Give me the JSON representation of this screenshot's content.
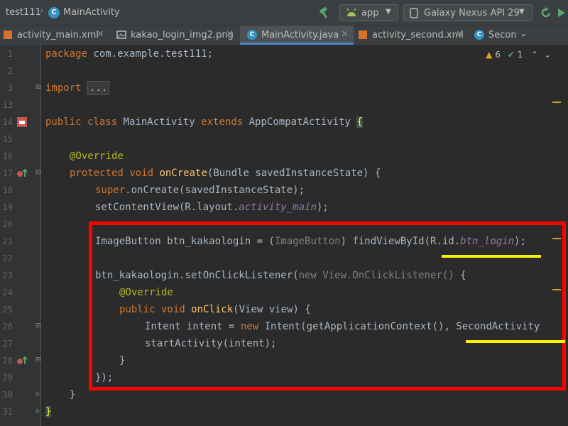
{
  "titlebar": {
    "project": "test111",
    "file": "MainActivity",
    "run_config": "app",
    "device": "Galaxy Nexus API 29"
  },
  "tabs": [
    {
      "label": "activity_main.xml",
      "kind": "xml"
    },
    {
      "label": "kakao_login_img2.png",
      "kind": "png"
    },
    {
      "label": "MainActivity.java",
      "kind": "java",
      "active": true
    },
    {
      "label": "activity_second.xml",
      "kind": "xml"
    },
    {
      "label": "Secon",
      "kind": "java"
    }
  ],
  "inspection": {
    "warnings": "6",
    "checks": "1"
  },
  "line_numbers": [
    "1",
    "2",
    "3",
    "13",
    "14",
    "15",
    "16",
    "17",
    "18",
    "19",
    "20",
    "21",
    "22",
    "23",
    "24",
    "25",
    "26",
    "27",
    "28",
    "29",
    "30",
    "31"
  ],
  "code": {
    "l1": {
      "kw": "package",
      "rest": " com.example.test111;"
    },
    "l3": {
      "kw": "import",
      "fold": "..."
    },
    "l14": {
      "kw1": "public class",
      "name": " MainActivity ",
      "kw2": "extends",
      "rest": " AppCompatActivity ",
      "brace": "{"
    },
    "l16": {
      "anno": "@Override"
    },
    "l17": {
      "kw": "protected void",
      "fn": "onCreate",
      "rest": "(Bundle savedInstanceState) {"
    },
    "l18": {
      "kw": "super",
      "rest": ".onCreate(savedInstanceState);"
    },
    "l19": {
      "pre": "setContentView(R.layout.",
      "it": "activity_main",
      "post": ");"
    },
    "l21": {
      "pre": "ImageButton btn_kakaologin = (",
      "cast": "ImageButton",
      "mid": ") findViewById(R.id.",
      "it": "btn_login",
      "post": ");"
    },
    "l23": {
      "pre": "btn_kakaologin.setOnClickListener(",
      "gray": "new View.OnClickListener()",
      "post": " {"
    },
    "l24": {
      "anno": "@Override"
    },
    "l25": {
      "kw": "public void",
      "fn": "onClick",
      "rest": "(View view) {"
    },
    "l26": {
      "pre": "Intent intent = ",
      "kw": "new",
      "mid": " Intent(getApplicationContext(), SecondActivity"
    },
    "l27": {
      "text": "startActivity(intent);"
    },
    "l29": {
      "text": "}"
    },
    "l30a": {
      "text": "});"
    },
    "l30": {
      "text": "}"
    },
    "l31": {
      "text": "}"
    }
  },
  "colors": {
    "highlight_box": "#ff0000",
    "underline": "#f5f500",
    "keyword": "#cc7832",
    "annotation": "#bbb529",
    "method": "#ffc66d"
  }
}
